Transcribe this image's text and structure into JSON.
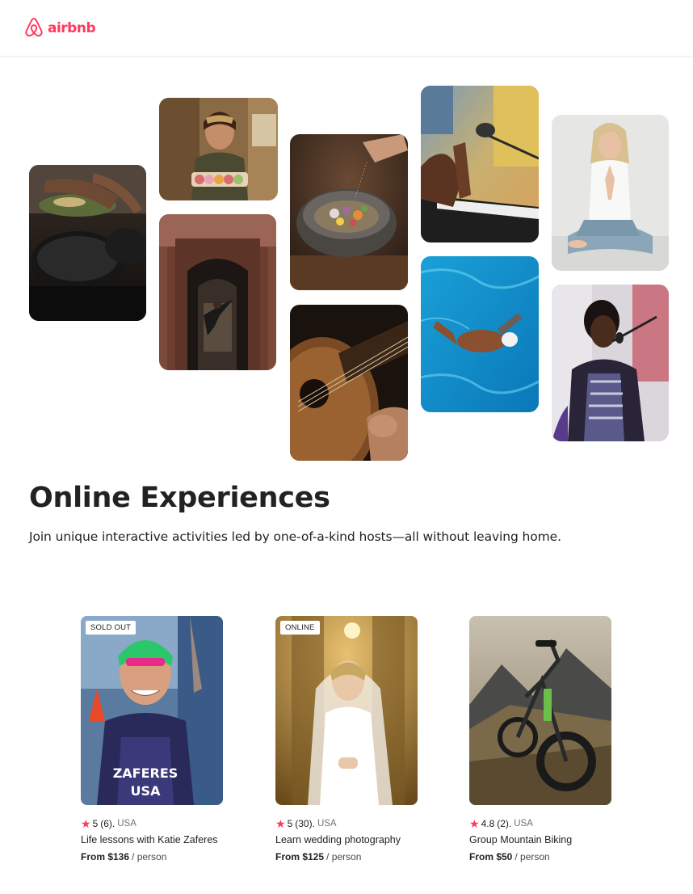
{
  "header": {
    "brand": "airbnb",
    "brand_color": "#ff385c"
  },
  "gallery": {
    "tiles": [
      {
        "name": "cooking-pan-photo",
        "icon": "cooking-photo"
      },
      {
        "name": "woman-macarons-photo",
        "icon": "baker-photo"
      },
      {
        "name": "dancer-doorway-photo",
        "icon": "dance-photo"
      },
      {
        "name": "gourmet-bowl-photo",
        "icon": "food-photo"
      },
      {
        "name": "guitar-photo",
        "icon": "guitar-photo"
      },
      {
        "name": "piano-microphone-photo",
        "icon": "music-photo"
      },
      {
        "name": "swimmer-pool-photo",
        "icon": "swim-photo"
      },
      {
        "name": "yoga-meditation-photo",
        "icon": "yoga-photo"
      },
      {
        "name": "singer-microphone-photo",
        "icon": "singer-photo"
      }
    ]
  },
  "section": {
    "title": "Online Experiences",
    "subtitle": "Join unique interactive activities led by one-of-a-kind hosts—all without leaving home."
  },
  "cards": [
    {
      "badge": "SOLD OUT",
      "rating": "5",
      "reviews": "(6).",
      "country": "USA",
      "title": "Life lessons with Katie Zaferes",
      "price": "From $136",
      "per": "/ person"
    },
    {
      "badge": "ONLINE",
      "rating": "5",
      "reviews": "(30).",
      "country": "USA",
      "title": "Learn wedding photography",
      "price": "From $125",
      "per": "/ person"
    },
    {
      "badge": "",
      "rating": "4.8",
      "reviews": "(2).",
      "country": "USA",
      "title": "Group Mountain Biking",
      "price": "From $50",
      "per": "/ person"
    }
  ]
}
